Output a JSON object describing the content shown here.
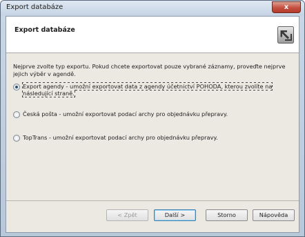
{
  "window": {
    "title": "Export databáze",
    "close_label": "x"
  },
  "header": {
    "title": "Export databáze",
    "icon": "export-arrow-icon"
  },
  "intro_text": "Nejprve zvolte typ exportu. Pokud chcete exportovat pouze vybrané záznamy, proveďte nejprve jejich výběr v agendě.",
  "options": [
    {
      "label": "Export agendy - umožní exportovat data z agendy účetnictví POHODA, kterou zvolíte na následující straně.",
      "checked": true
    },
    {
      "label": "Česká pošta - umožní exportovat podací archy pro objednávku přepravy.",
      "checked": false
    },
    {
      "label": "TopTrans - umožní exportovat podací archy pro objednávku přepravy.",
      "checked": false
    }
  ],
  "buttons": {
    "back": "< Zpět",
    "next": "Další >",
    "cancel": "Storno",
    "help": "Nápověda"
  }
}
